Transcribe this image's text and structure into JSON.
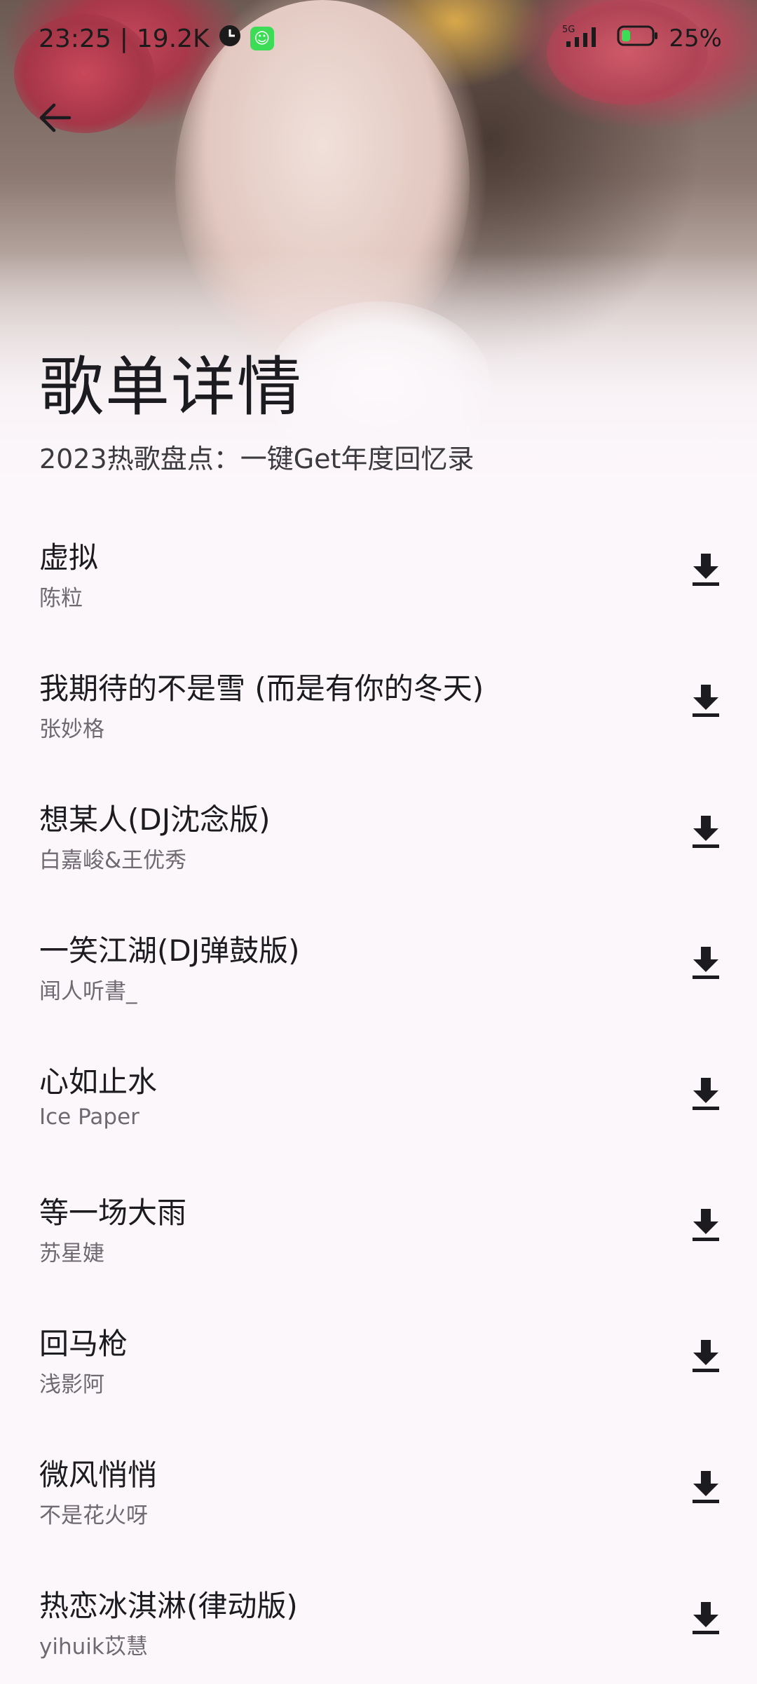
{
  "status_bar": {
    "time": "23:25",
    "speed": "19.2K",
    "network": "5G",
    "battery": "25%"
  },
  "header": {
    "back_icon": "arrow-left-icon",
    "title": "歌单详情",
    "subtitle": "2023热歌盘点：一键Get年度回忆录"
  },
  "songs": [
    {
      "title": "虚拟",
      "artist": "陈粒"
    },
    {
      "title": "我期待的不是雪 (而是有你的冬天)",
      "artist": "张妙格"
    },
    {
      "title": "想某人(DJ沈念版)",
      "artist": "白嘉峻&王优秀"
    },
    {
      "title": "一笑江湖(DJ弹鼓版)",
      "artist": "闻人听書_"
    },
    {
      "title": "心如止水",
      "artist": "Ice Paper"
    },
    {
      "title": "等一场大雨",
      "artist": "苏星婕"
    },
    {
      "title": "回马枪",
      "artist": "浅影阿"
    },
    {
      "title": "微风悄悄",
      "artist": "不是花火呀"
    },
    {
      "title": "热恋冰淇淋(律动版)",
      "artist": "yihuik苡慧"
    }
  ],
  "colors": {
    "background": "#fcf7fb",
    "text_primary": "#1c1b1f",
    "text_secondary": "#6f6a72",
    "icon": "#1c1b1f"
  }
}
